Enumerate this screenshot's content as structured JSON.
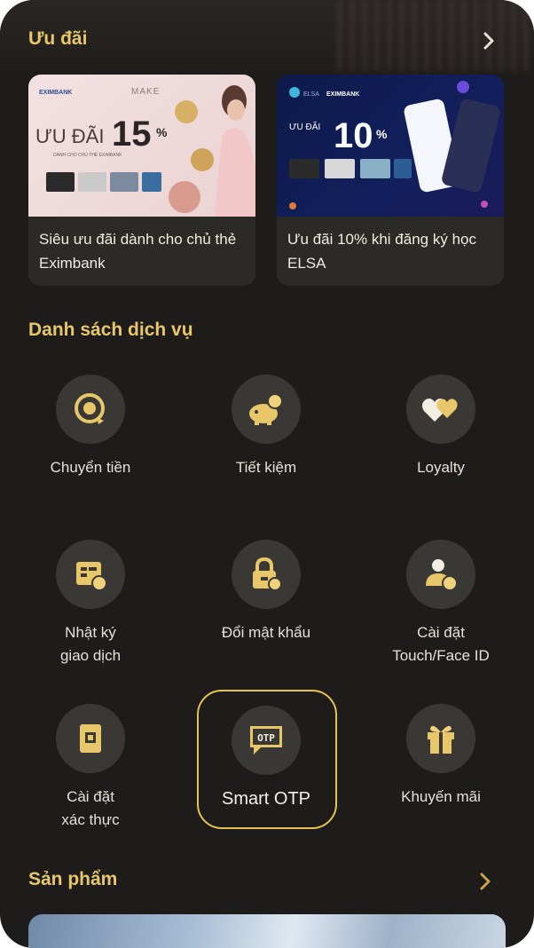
{
  "offers": {
    "title": "Ưu đãi",
    "cards": [
      {
        "caption": "Siêu ưu đãi dành cho chủ thẻ Eximbank",
        "banner": {
          "bank": "EXIMBANK",
          "partner": "MAKE",
          "headline": "ƯU ĐÃI",
          "value": "15",
          "unit": "%",
          "sub": "DÀNH CHO CHỦ THẺ EXIMBANK"
        }
      },
      {
        "caption": "Ưu đãi 10% khi đăng ký học ELSA",
        "banner": {
          "bank": "EXIMBANK",
          "partner": "ELSA",
          "headline": "ƯU ĐÃI",
          "value": "10",
          "unit": "%"
        }
      }
    ]
  },
  "services": {
    "title": "Danh sách dịch vụ",
    "items": [
      {
        "label": "Chuyển tiền",
        "icon": "transfer-icon"
      },
      {
        "label": "Tiết kiệm",
        "icon": "piggy-bank-icon"
      },
      {
        "label": "Loyalty",
        "icon": "hearts-icon"
      },
      {
        "label": "Nhật ký\ngiao dịch",
        "icon": "transaction-log-icon"
      },
      {
        "label": "Đổi mật khẩu",
        "icon": "lock-icon"
      },
      {
        "label": "Cài đặt\nTouch/Face ID",
        "icon": "user-settings-icon"
      },
      {
        "label": "Cài đặt\nxác thực",
        "icon": "authentication-icon"
      },
      {
        "label": "Smart OTP",
        "icon": "otp-icon",
        "badge": "OTP",
        "highlighted": true
      },
      {
        "label": "Khuyến mãi",
        "icon": "gift-icon"
      }
    ]
  },
  "products": {
    "title": "Sản phẩm"
  },
  "colors": {
    "background": "#1e1c1a",
    "accent_gold": "#e8c66a",
    "icon_circle": "#3a3834",
    "highlight_border": "#e8c24c"
  }
}
